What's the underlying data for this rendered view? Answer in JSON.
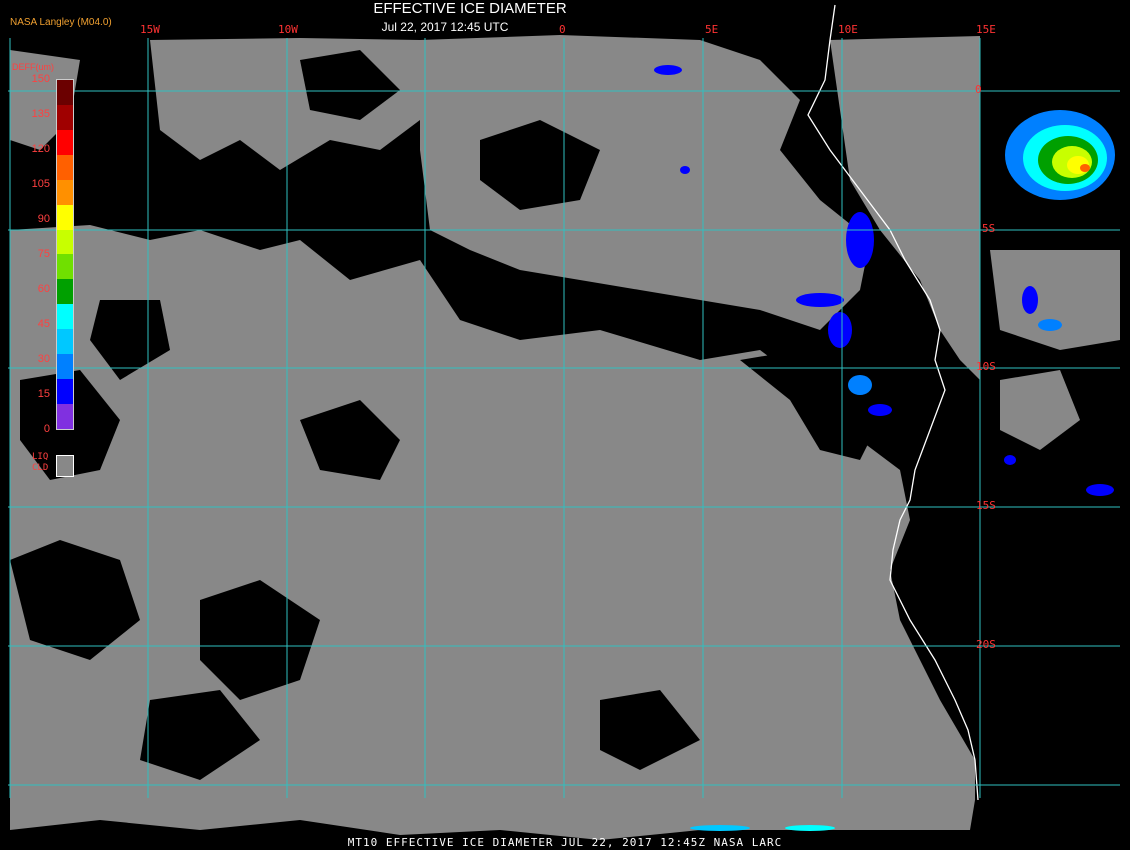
{
  "header": {
    "title": "EFFECTIVE ICE DIAMETER",
    "subtitle": "Jul 22, 2017 12:45 UTC",
    "credit": "NASA Langley (M04.0)"
  },
  "footer": "MT10  EFFECTIVE ICE DIAMETER   JUL 22, 2017 12:45Z   NASA LARC",
  "longitude_labels": [
    "15W",
    "10W",
    "0",
    "5E",
    "10E",
    "15E"
  ],
  "latitude_labels": [
    "0",
    "5S",
    "10S",
    "15S",
    "20S"
  ],
  "legend": {
    "title": "DEFF(um)",
    "ticks": [
      "150",
      "135",
      "120",
      "105",
      "90",
      "75",
      "60",
      "45",
      "30",
      "15",
      "0"
    ],
    "colors": [
      "#6b0000",
      "#a00000",
      "#ff0000",
      "#ff6000",
      "#ff9000",
      "#ffff00",
      "#c8ff00",
      "#70e000",
      "#00a000",
      "#00ffff",
      "#00c8ff",
      "#0080ff",
      "#0000ff",
      "#8030e0"
    ],
    "liquid_label": "LIQ CLD",
    "liquid_color": "#888888"
  },
  "colors": {
    "grid": "#30c0c0",
    "coast": "#ffffff",
    "liquid_cloud": "#888888",
    "clear": "#000000"
  }
}
